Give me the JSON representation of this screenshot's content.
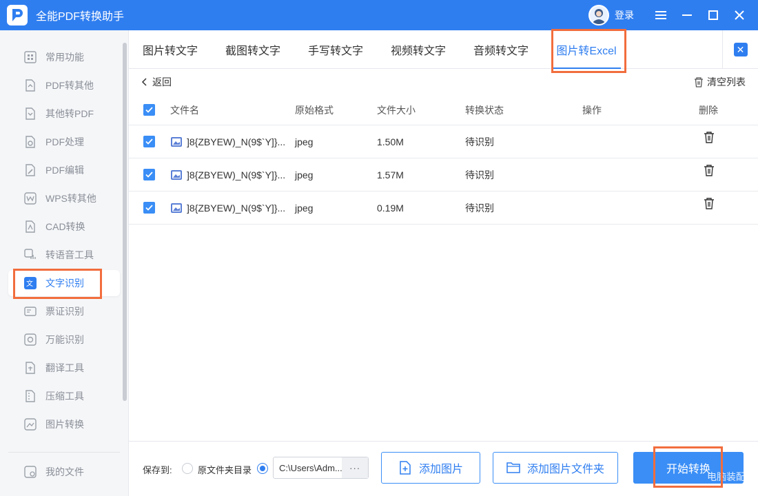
{
  "app": {
    "title": "全能PDF转换助手",
    "login_label": "登录"
  },
  "sidebar": {
    "items": [
      {
        "label": "常用功能",
        "icon": "grid-icon"
      },
      {
        "label": "PDF转其他",
        "icon": "pdf-export-icon"
      },
      {
        "label": "其他转PDF",
        "icon": "pdf-import-icon"
      },
      {
        "label": "PDF处理",
        "icon": "pdf-process-icon"
      },
      {
        "label": "PDF编辑",
        "icon": "pdf-edit-icon"
      },
      {
        "label": "WPS转其他",
        "icon": "wps-icon"
      },
      {
        "label": "CAD转换",
        "icon": "cad-icon"
      },
      {
        "label": "转语音工具",
        "icon": "voice-icon"
      },
      {
        "label": "文字识别",
        "icon": "ocr-icon"
      },
      {
        "label": "票证识别",
        "icon": "ticket-icon"
      },
      {
        "label": "万能识别",
        "icon": "universal-icon"
      },
      {
        "label": "翻译工具",
        "icon": "translate-icon"
      },
      {
        "label": "压缩工具",
        "icon": "compress-icon"
      },
      {
        "label": "图片转换",
        "icon": "image-convert-icon"
      }
    ],
    "my_files": "我的文件",
    "active_index": 8
  },
  "tabs": [
    {
      "label": "图片转文字"
    },
    {
      "label": "截图转文字"
    },
    {
      "label": "手写转文字"
    },
    {
      "label": "视频转文字"
    },
    {
      "label": "音频转文字"
    },
    {
      "label": "图片转Excel"
    }
  ],
  "toolbar": {
    "back_label": "返回",
    "clear_label": "清空列表"
  },
  "table": {
    "headers": {
      "filename": "文件名",
      "format": "原始格式",
      "size": "文件大小",
      "status": "转换状态",
      "action": "操作",
      "delete": "删除"
    },
    "rows": [
      {
        "name": "]8{ZBYEW)_N(9$`Y]}...",
        "format": "jpeg",
        "size": "1.50M",
        "status": "待识别"
      },
      {
        "name": "]8{ZBYEW)_N(9$`Y]}...",
        "format": "jpeg",
        "size": "1.57M",
        "status": "待识别"
      },
      {
        "name": "]8{ZBYEW)_N(9$`Y]}...",
        "format": "jpeg",
        "size": "0.19M",
        "status": "待识别"
      }
    ]
  },
  "footer": {
    "save_to_label": "保存到:",
    "option_original": "原文件夹目录",
    "path_value": "C:\\Users\\Adm...",
    "path_more": "···",
    "add_image": "添加图片",
    "add_folder": "添加图片文件夹",
    "start": "开始转换"
  },
  "watermark": "电脑装配网",
  "colors": {
    "accent": "#2f7ef0",
    "highlight": "#f26d3d"
  }
}
